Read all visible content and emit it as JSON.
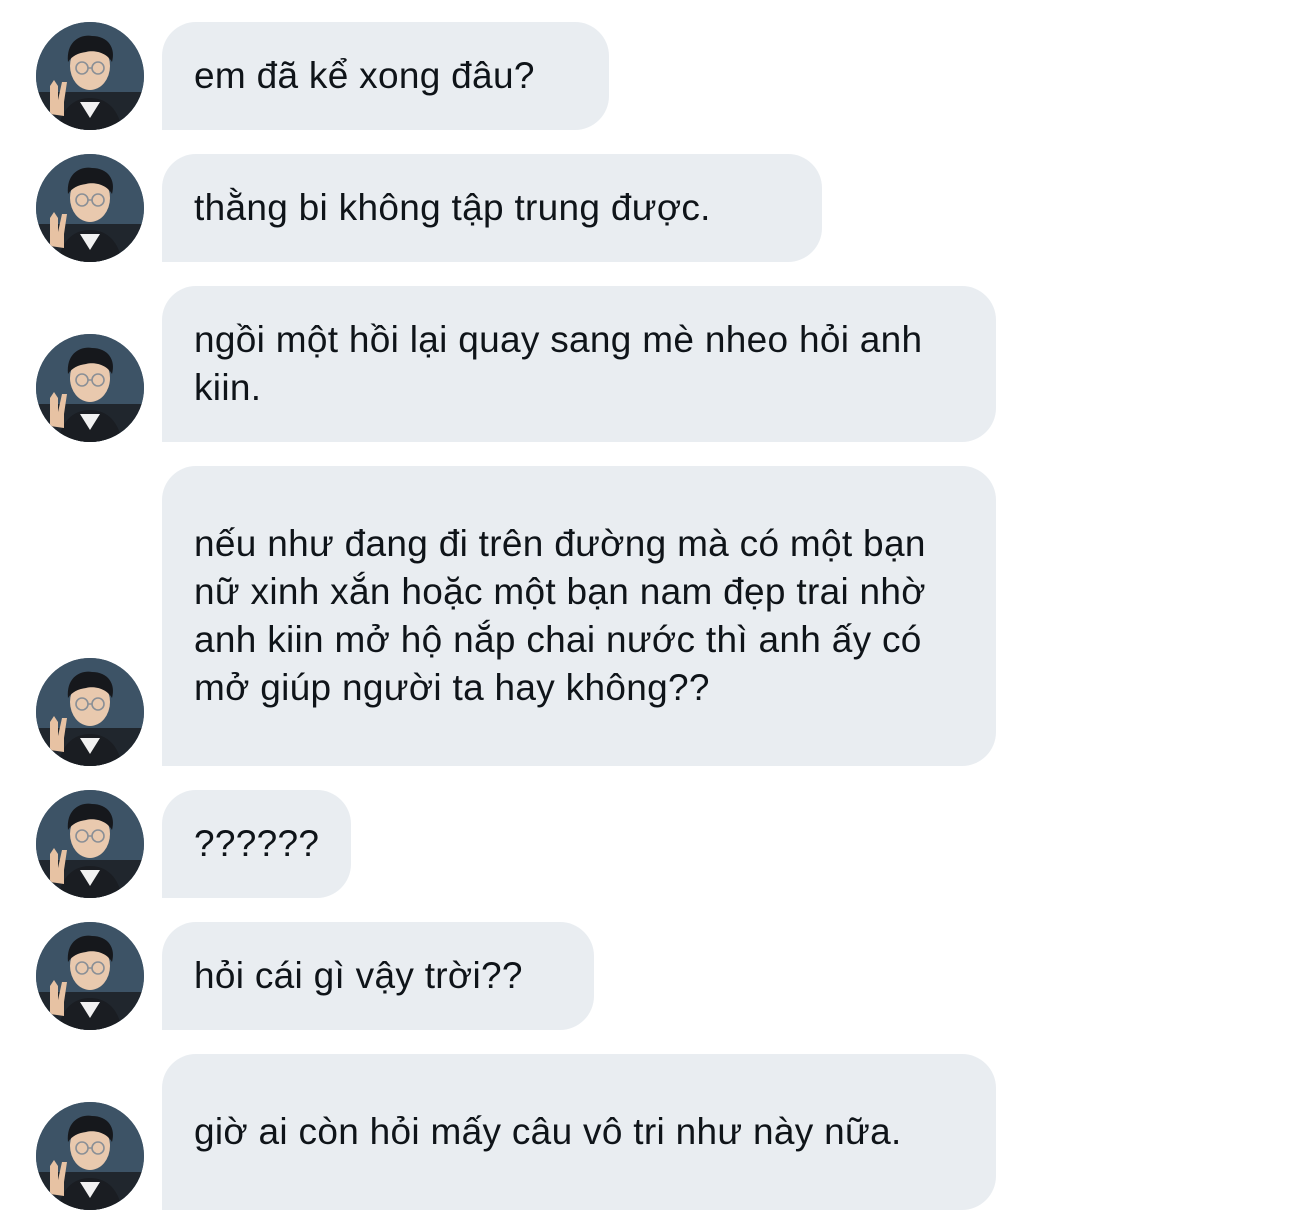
{
  "conversation": {
    "avatar_icon": "profile-photo-peace-sign",
    "bubble_color": "#e9edf1",
    "text_color": "#0f1419",
    "messages": [
      {
        "text": "em đã kể xong đâu?"
      },
      {
        "text": "thằng bi không tập trung được."
      },
      {
        "text": "ngồi một hồi lại quay sang mè nheo hỏi anh kiin."
      },
      {
        "text": "nếu như đang đi trên đường mà có một bạn nữ xinh xắn hoặc một bạn nam đẹp trai nhờ anh kiin mở hộ nắp chai nước thì anh ấy có mở giúp người ta hay không??"
      },
      {
        "text": "??????"
      },
      {
        "text": "hỏi cái gì vậy trời??"
      },
      {
        "text": "giờ ai còn hỏi mấy câu vô tri như này nữa."
      }
    ]
  }
}
